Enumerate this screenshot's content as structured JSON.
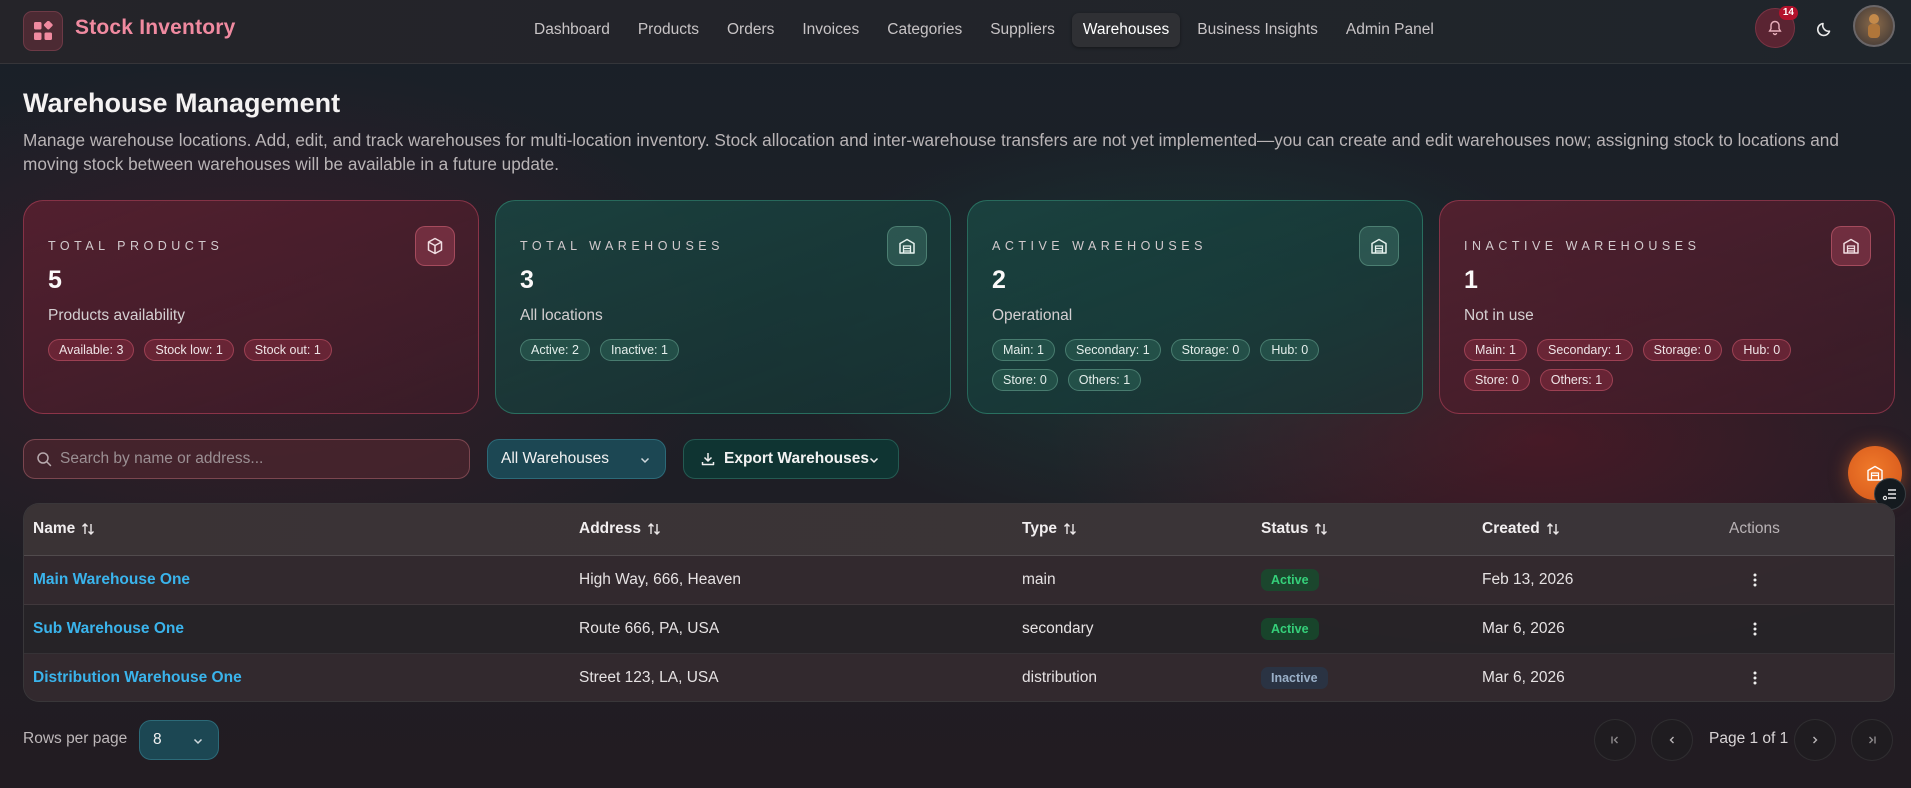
{
  "app": {
    "brand": "Stock Inventory",
    "notifications_count": "14"
  },
  "nav": [
    {
      "label": "Dashboard"
    },
    {
      "label": "Products"
    },
    {
      "label": "Orders"
    },
    {
      "label": "Invoices"
    },
    {
      "label": "Categories"
    },
    {
      "label": "Suppliers"
    },
    {
      "label": "Warehouses",
      "active": true
    },
    {
      "label": "Business Insights"
    },
    {
      "label": "Admin Panel"
    }
  ],
  "header": {
    "title": "Warehouse Management",
    "description": "Manage warehouse locations. Add, edit, and track warehouses for multi-location inventory. Stock allocation and inter-warehouse transfers are not yet implemented—you can create and edit warehouses now; assigning stock to locations and moving stock between warehouses will be available in a future update."
  },
  "cards": [
    {
      "label": "Total Products",
      "value": "5",
      "sub": "Products availability",
      "icon": "cube-icon",
      "chips": [
        "Available: 3",
        "Stock low: 1",
        "Stock out: 1"
      ]
    },
    {
      "label": "Total Warehouses",
      "value": "3",
      "sub": "All locations",
      "icon": "warehouse-icon",
      "chips": [
        "Active: 2",
        "Inactive: 1"
      ]
    },
    {
      "label": "Active Warehouses",
      "value": "2",
      "sub": "Operational",
      "icon": "warehouse-icon",
      "chips": [
        "Main: 1",
        "Secondary: 1",
        "Storage: 0",
        "Hub: 0",
        "Store: 0",
        "Others: 1"
      ]
    },
    {
      "label": "Inactive Warehouses",
      "value": "1",
      "sub": "Not in use",
      "icon": "warehouse-icon",
      "chips": [
        "Main: 1",
        "Secondary: 1",
        "Storage: 0",
        "Hub: 0",
        "Store: 0",
        "Others: 1"
      ]
    }
  ],
  "toolbar": {
    "search_placeholder": "Search by name or address...",
    "filter_value": "All Warehouses",
    "export_label": "Export Warehouses"
  },
  "table": {
    "headers": {
      "name": "Name",
      "address": "Address",
      "type": "Type",
      "status": "Status",
      "created": "Created",
      "actions": "Actions"
    },
    "rows": [
      {
        "name": "Main Warehouse One",
        "address": "High Way, 666, Heaven",
        "type": "main",
        "status": "Active",
        "created": "Feb 13, 2026"
      },
      {
        "name": "Sub Warehouse One",
        "address": "Route 666, PA, USA",
        "type": "secondary",
        "status": "Active",
        "created": "Mar 6, 2026"
      },
      {
        "name": "Distribution Warehouse One",
        "address": "Street 123, LA, USA",
        "type": "distribution",
        "status": "Inactive",
        "created": "Mar 6, 2026"
      }
    ]
  },
  "footer": {
    "rows_per_page_label": "Rows per page",
    "rows_per_page_value": "8",
    "page_label": "Page 1 of 1"
  },
  "colors": {
    "accent_pink": "#f08aa0",
    "link_blue": "#3ab4ec",
    "active_green": "#35d07a",
    "fab_orange": "#f07a2a"
  }
}
